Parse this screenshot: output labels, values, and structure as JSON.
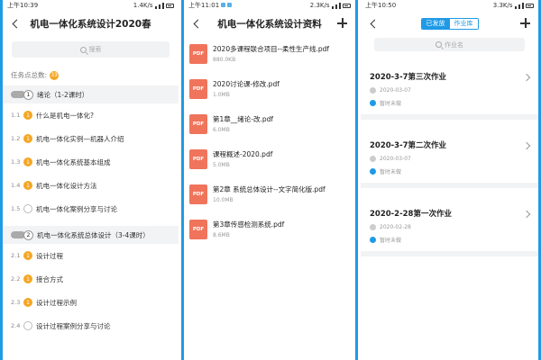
{
  "screen1": {
    "status_time": "上午10:39",
    "status_speed": "1.4K/s",
    "title": "机电一体化系统设计2020春",
    "search_placeholder": "搜索",
    "task_total_label": "任务点总数:",
    "task_total_badge": "33",
    "chapters": [
      {
        "num": "1",
        "title": "绪论（1-2课时）",
        "lessons": [
          {
            "num": "1.1",
            "title": "什么是机电一体化?",
            "done": true,
            "badge": "1"
          },
          {
            "num": "1.2",
            "title": "机电一体化实例—机器人介绍",
            "done": true,
            "badge": "1"
          },
          {
            "num": "1.3",
            "title": "机电一体化系统基本组成",
            "done": true,
            "badge": "1"
          },
          {
            "num": "1.4",
            "title": "机电一体化设计方法",
            "done": true,
            "badge": "1"
          },
          {
            "num": "1.5",
            "title": "机电一体化案例分享与讨论",
            "done": false,
            "badge": ""
          }
        ]
      },
      {
        "num": "2",
        "title": "机电一体化系统总体设计（3-4课时）",
        "lessons": [
          {
            "num": "2.1",
            "title": "设计过程",
            "done": true,
            "badge": "1"
          },
          {
            "num": "2.2",
            "title": "接合方式",
            "done": true,
            "badge": "1"
          },
          {
            "num": "2.3",
            "title": "设计过程示例",
            "done": true,
            "badge": "1"
          },
          {
            "num": "2.4",
            "title": "设计过程案例分享与讨论",
            "done": false,
            "badge": ""
          }
        ]
      }
    ]
  },
  "screen2": {
    "status_time": "上午11:01",
    "status_speed": "2.3K/s",
    "title": "机电一体化系统设计资料",
    "pdf_icon_label": "PDF",
    "files": [
      {
        "name": "2020多课程联合项目--柔性生产线.pdf",
        "size": "880.0KB"
      },
      {
        "name": "2020讨论课-修改.pdf",
        "size": "1.0MB"
      },
      {
        "name": "第1章__绪论-改.pdf",
        "size": "6.0MB"
      },
      {
        "name": "课程概述-2020.pdf",
        "size": "5.0MB"
      },
      {
        "name": "第2章 系统总体设计--文字简化版.pdf",
        "size": "10.0MB"
      },
      {
        "name": "第3章传感检测系统.pdf",
        "size": "8.6MB"
      }
    ]
  },
  "screen3": {
    "status_time": "上午10:50",
    "status_speed": "3.3K/s",
    "tab_published": "已发放",
    "tab_library": "作业库",
    "search_placeholder": "作业名",
    "homeworks": [
      {
        "title": "2020-3-7第三次作业",
        "date": "2020-03-07",
        "status": "暂时未做"
      },
      {
        "title": "2020-3-7第二次作业",
        "date": "2020-03-07",
        "status": "暂时未做"
      },
      {
        "title": "2020-2-28第一次作业",
        "date": "2020-02-28",
        "status": "暂时未做"
      }
    ]
  },
  "colors": {
    "accent": "#1f9ae6",
    "done_badge": "#f5a623",
    "pdf": "#f0745b"
  }
}
